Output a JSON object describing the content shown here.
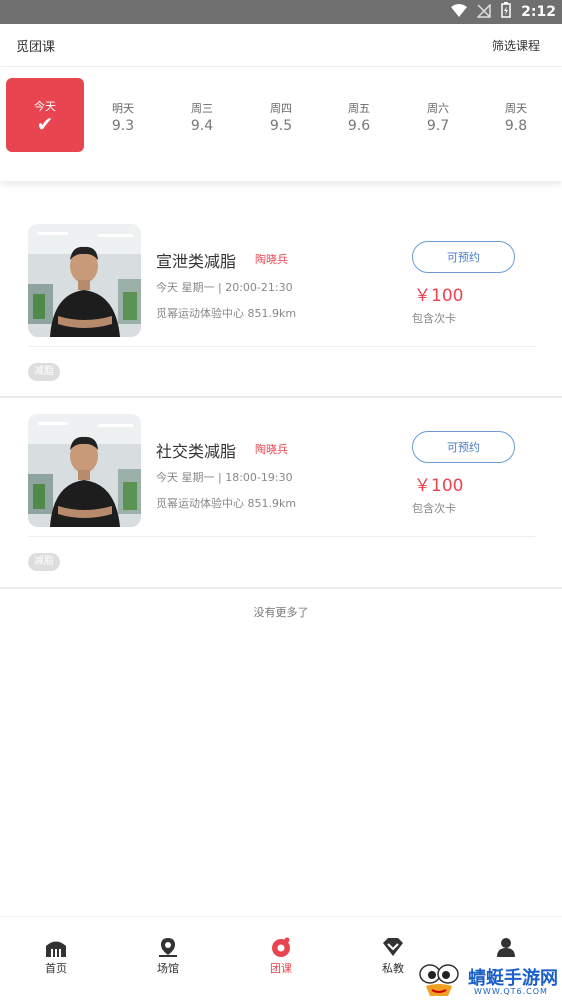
{
  "status_bar": {
    "time": "2:12"
  },
  "header": {
    "title": "觅团课",
    "filter": "筛选课程"
  },
  "dates": [
    {
      "label": "今天",
      "date": "",
      "selected": true
    },
    {
      "label": "明天",
      "date": "9.3"
    },
    {
      "label": "周三",
      "date": "9.4"
    },
    {
      "label": "周四",
      "date": "9.5"
    },
    {
      "label": "周五",
      "date": "9.6"
    },
    {
      "label": "周六",
      "date": "9.7"
    },
    {
      "label": "周天",
      "date": "9.8"
    }
  ],
  "classes": [
    {
      "name": "宣泄类减脂",
      "coach": "陶晓兵",
      "time": "今天 星期一 | 20:00-21:30",
      "venue": "觅幂运动体验中心 851.9km",
      "button": "可预约",
      "price": "￥100",
      "note": "包含次卡",
      "tag": "减脂"
    },
    {
      "name": "社交类减脂",
      "coach": "陶晓兵",
      "time": "今天 星期一 | 18:00-19:30",
      "venue": "觅幂运动体验中心 851.9km",
      "button": "可预约",
      "price": "￥100",
      "note": "包含次卡",
      "tag": "减脂"
    }
  ],
  "no_more": "没有更多了",
  "tabs": [
    {
      "label": "首页",
      "icon": "home-icon"
    },
    {
      "label": "场馆",
      "icon": "location-icon"
    },
    {
      "label": "团课",
      "icon": "group-class-icon",
      "active": true
    },
    {
      "label": "私教",
      "icon": "diamond-icon"
    },
    {
      "label": "",
      "icon": "person-icon"
    }
  ],
  "watermark": {
    "text": "蜻蜓手游网",
    "url": "WWW.QT6.COM"
  },
  "colors": {
    "accent": "#e94550",
    "button_blue": "#4a7bc8"
  }
}
